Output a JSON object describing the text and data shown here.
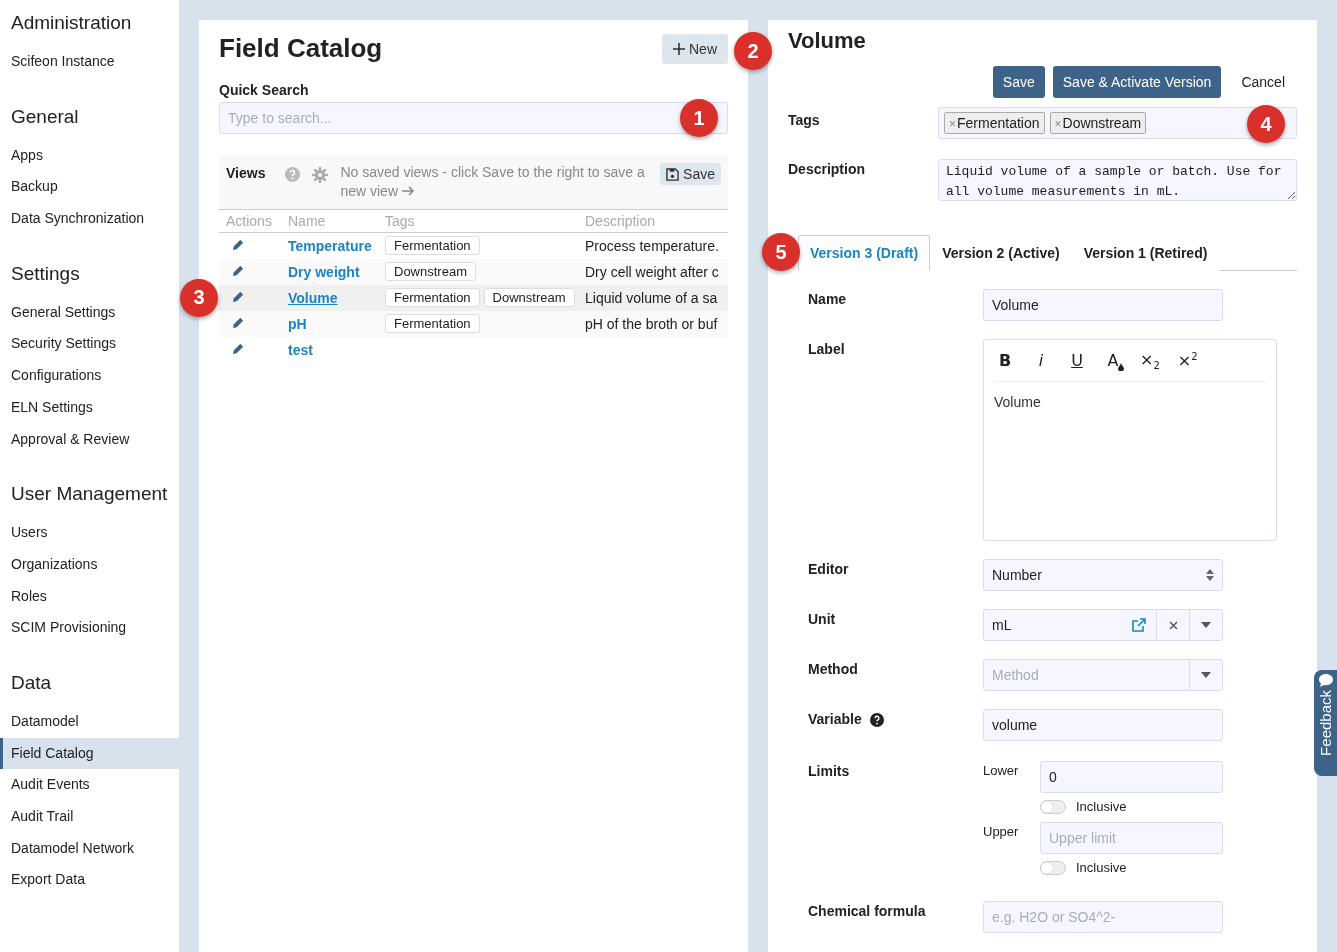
{
  "sidebar": {
    "sections": [
      {
        "heading": "Administration",
        "items": [
          {
            "label": "Scifeon Instance",
            "selected": false
          }
        ]
      },
      {
        "heading": "General",
        "items": [
          {
            "label": "Apps",
            "selected": false
          },
          {
            "label": "Backup",
            "selected": false
          },
          {
            "label": "Data Synchronization",
            "selected": false
          }
        ]
      },
      {
        "heading": "Settings",
        "items": [
          {
            "label": "General Settings",
            "selected": false
          },
          {
            "label": "Security Settings",
            "selected": false
          },
          {
            "label": "Configurations",
            "selected": false
          },
          {
            "label": "ELN Settings",
            "selected": false
          },
          {
            "label": "Approval & Review",
            "selected": false
          }
        ]
      },
      {
        "heading": "User Management",
        "items": [
          {
            "label": "Users",
            "selected": false
          },
          {
            "label": "Organizations",
            "selected": false
          },
          {
            "label": "Roles",
            "selected": false
          },
          {
            "label": "SCIM Provisioning",
            "selected": false
          }
        ]
      },
      {
        "heading": "Data",
        "items": [
          {
            "label": "Datamodel",
            "selected": false
          },
          {
            "label": "Field Catalog",
            "selected": true
          },
          {
            "label": "Audit Events",
            "selected": false
          },
          {
            "label": "Audit Trail",
            "selected": false
          },
          {
            "label": "Datamodel Network",
            "selected": false
          },
          {
            "label": "Export Data",
            "selected": false
          }
        ]
      }
    ]
  },
  "catalog": {
    "title": "Field Catalog",
    "new_button": "New",
    "new_callout": "2",
    "search": {
      "label": "Quick Search",
      "placeholder": "Type to search...",
      "callout": "1"
    },
    "views": {
      "label": "Views",
      "message": "No saved views - click Save to the right to save a new view",
      "save_button": "Save"
    },
    "table": {
      "columns": [
        "Actions",
        "Name",
        "Tags",
        "Description"
      ],
      "rows": [
        {
          "name": "Temperature",
          "tags": [
            "Fermentation"
          ],
          "description": "Process temperature.",
          "selected": false
        },
        {
          "name": "Dry weight",
          "tags": [
            "Downstream"
          ],
          "description": "Dry cell weight after c",
          "selected": false
        },
        {
          "name": "Volume",
          "tags": [
            "Fermentation",
            "Downstream"
          ],
          "description": "Liquid volume of a sa",
          "selected": true,
          "callout": "3"
        },
        {
          "name": "pH",
          "tags": [
            "Fermentation"
          ],
          "description": "pH of the broth or buf",
          "selected": false
        },
        {
          "name": "test",
          "tags": [],
          "description": "",
          "selected": false
        }
      ]
    }
  },
  "detail": {
    "title": "Volume",
    "buttons": [
      {
        "label": "Save",
        "kind": "primary"
      },
      {
        "label": "Save & Activate Version",
        "kind": "primary"
      },
      {
        "label": "Cancel",
        "kind": "plain"
      }
    ],
    "tags": {
      "label": "Tags",
      "chips": [
        {
          "remove": "×",
          "label": "Fermentation"
        },
        {
          "remove": "×",
          "label": "Downstream"
        }
      ],
      "callout": "4"
    },
    "description": {
      "label": "Description",
      "value": "Liquid volume of a sample or batch. Use for all volume measurements in mL."
    },
    "tabs_callout": "5",
    "tabs": [
      {
        "label": "Version 3 (Draft)",
        "selected": true
      },
      {
        "label": "Version 2 (Active)",
        "selected": false
      },
      {
        "label": "Version 1 (Retired)",
        "selected": false
      }
    ],
    "form": [
      {
        "kind": "text",
        "label": "Name",
        "value": "Volume"
      },
      {
        "kind": "rich",
        "label": "Label",
        "value": "Volume",
        "toolbar": [
          {
            "kind": "bold",
            "glyph": "B"
          },
          {
            "kind": "italic",
            "glyph": "i"
          },
          {
            "kind": "underline",
            "glyph": "U"
          },
          {
            "kind": "color",
            "glyph": "A"
          },
          {
            "kind": "script",
            "glyph": "×$_{2}$"
          },
          {
            "kind": "script",
            "glyph": "×$^{2}$"
          }
        ]
      },
      {
        "kind": "select",
        "label": "Editor",
        "value": "Number"
      },
      {
        "kind": "lookup",
        "label": "Unit",
        "value": "mL"
      },
      {
        "kind": "dropdown",
        "label": "Method",
        "placeholder": "Method"
      },
      {
        "kind": "text",
        "label": "Variable",
        "value": "volume",
        "help": true
      },
      {
        "kind": "limits",
        "label": "Limits",
        "limits": [
          {
            "label": "Lower",
            "value": "0",
            "toggle": "Inclusive",
            "on": false
          },
          {
            "label": "Upper",
            "placeholder": "Upper limit",
            "toggle": "Inclusive",
            "on": false
          }
        ]
      },
      {
        "kind": "text",
        "label": "Chemical formula",
        "placeholder": "e.g. H2O or SO4^2-"
      }
    ]
  },
  "feedback": "Feedback"
}
